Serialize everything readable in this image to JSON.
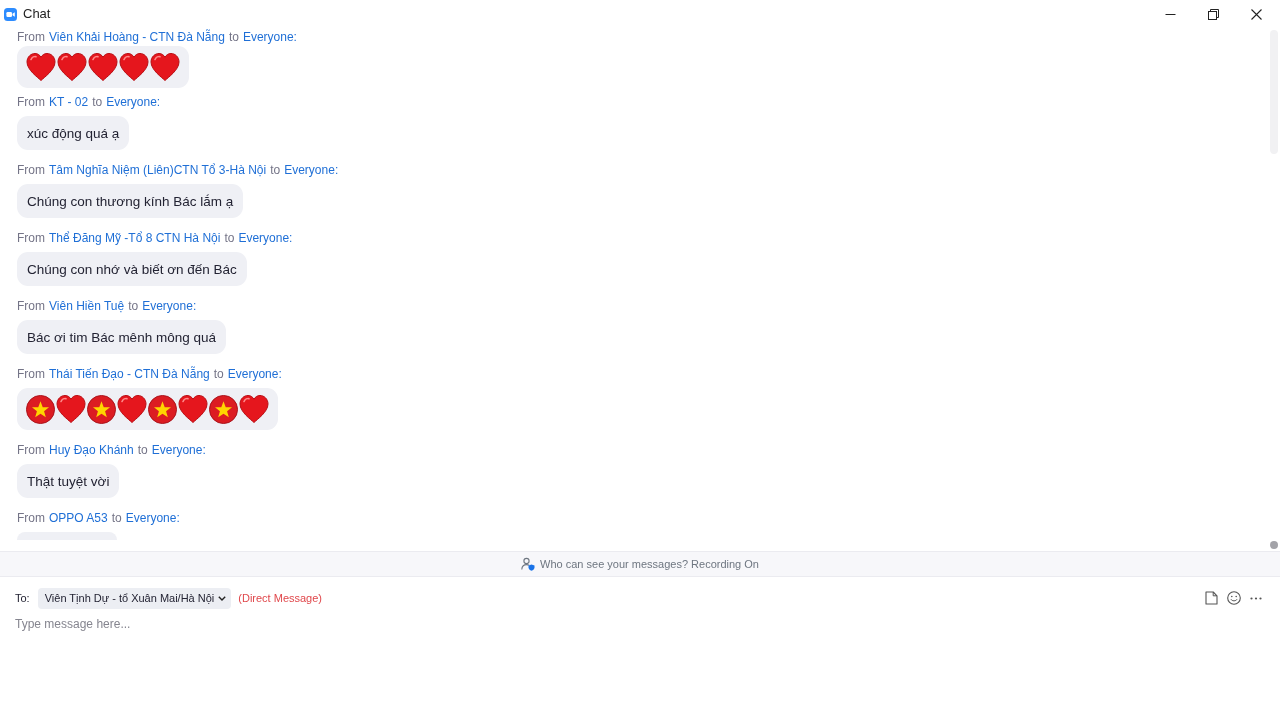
{
  "window": {
    "title": "Chat"
  },
  "messages": [
    {
      "from": "From",
      "sender": "Viên Khải Hoàng - CTN Đà Nẵng",
      "to": "to",
      "recipient": "Everyone:",
      "kind": "emoji",
      "emojis": [
        {
          "kind": "heart"
        },
        {
          "kind": "heart"
        },
        {
          "kind": "heart"
        },
        {
          "kind": "heart"
        },
        {
          "kind": "heart"
        }
      ]
    },
    {
      "from": "From",
      "sender": "KT - 02",
      "to": "to",
      "recipient": "Everyone:",
      "kind": "text",
      "text": "xúc động quá ạ"
    },
    {
      "from": "From",
      "sender": "Tâm Nghĩa Niệm (Liên)CTN Tổ 3-Hà Nội",
      "to": "to",
      "recipient": "Everyone:",
      "kind": "text",
      "text": "Chúng con thương kính Bác lắm ạ"
    },
    {
      "from": "From",
      "sender": "Thể Đăng Mỹ -Tổ 8 CTN Hà Nội",
      "to": "to",
      "recipient": "Everyone:",
      "kind": "text",
      "text": "Chúng con nhớ và biết ơn đến Bác"
    },
    {
      "from": "From",
      "sender": "Viên Hiền Tuệ",
      "to": "to",
      "recipient": "Everyone:",
      "kind": "text",
      "text": "Bác ơi tim Bác mênh mông quá"
    },
    {
      "from": "From",
      "sender": "Thái Tiến Đạo - CTN Đà Nẵng",
      "to": "to",
      "recipient": "Everyone:",
      "kind": "emoji",
      "emojis": [
        {
          "kind": "star-disc"
        },
        {
          "kind": "heart"
        },
        {
          "kind": "star-disc"
        },
        {
          "kind": "heart"
        },
        {
          "kind": "star-disc"
        },
        {
          "kind": "heart"
        },
        {
          "kind": "star-disc"
        },
        {
          "kind": "heart"
        }
      ]
    },
    {
      "from": "From",
      "sender": "Huy Đạo Khánh",
      "to": "to",
      "recipient": "Everyone:",
      "kind": "text",
      "text": "Thật tuyệt vời"
    },
    {
      "from": "From",
      "sender": "OPPO A53",
      "to": "to",
      "recipient": "Everyone:",
      "kind": "covered"
    }
  ],
  "notice": {
    "text": "Who can see your messages? Recording On"
  },
  "compose": {
    "to_label": "To:",
    "recipient": "Viên Tịnh Dự - tổ Xuân Mai/Hà Nội",
    "mode": "(Direct Message)",
    "placeholder": "Type message here..."
  }
}
